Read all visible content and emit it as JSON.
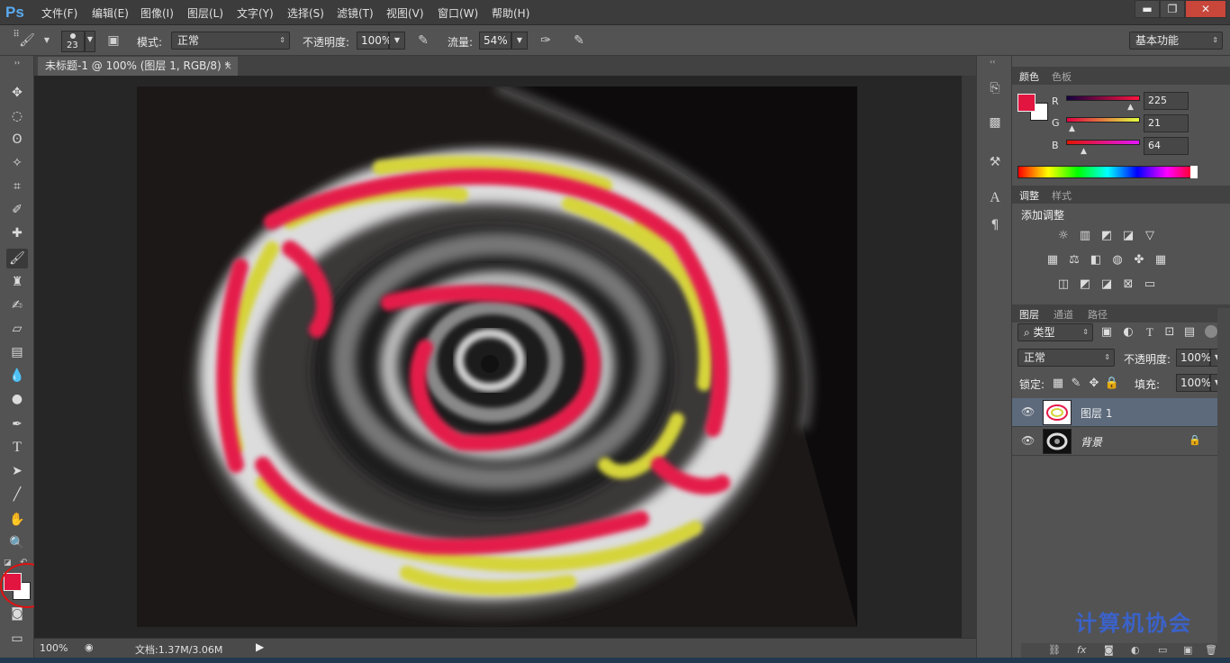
{
  "app": {
    "logo": "Ps"
  },
  "menu": [
    "文件(F)",
    "编辑(E)",
    "图像(I)",
    "图层(L)",
    "文字(Y)",
    "选择(S)",
    "滤镜(T)",
    "视图(V)",
    "窗口(W)",
    "帮助(H)"
  ],
  "window_controls": {
    "minimize": "▬",
    "restore": "❐",
    "close": "✕"
  },
  "options": {
    "brush_size": "23",
    "mode_label": "模式:",
    "mode_value": "正常",
    "opacity_label": "不透明度:",
    "opacity_value": "100%",
    "flow_label": "流量:",
    "flow_value": "54%",
    "workspace": "基本功能"
  },
  "document": {
    "tab_title": "未标题-1 @ 100% (图层 1, RGB/8) *",
    "tab_close": "×",
    "zoom": "100%",
    "doc_info": "文档:1.37M/3.06M"
  },
  "color_panel": {
    "tabs": [
      "颜色",
      "色板"
    ],
    "r_label": "R",
    "g_label": "G",
    "b_label": "B",
    "r": "225",
    "g": "21",
    "b": "64",
    "foreground": "#e11540",
    "background": "#ffffff"
  },
  "adjust_panel": {
    "tabs": [
      "调整",
      "样式"
    ],
    "title": "添加调整"
  },
  "layers_panel": {
    "tabs": [
      "图层",
      "通道",
      "路径"
    ],
    "filter_kind": "类型",
    "blend_mode": "正常",
    "opacity_label": "不透明度:",
    "opacity_value": "100%",
    "lock_label": "锁定:",
    "fill_label": "填充:",
    "fill_value": "100%",
    "layers": [
      {
        "name": "图层 1",
        "selected": true
      },
      {
        "name": "背景",
        "selected": false
      }
    ]
  },
  "watermark": "计算机协会"
}
